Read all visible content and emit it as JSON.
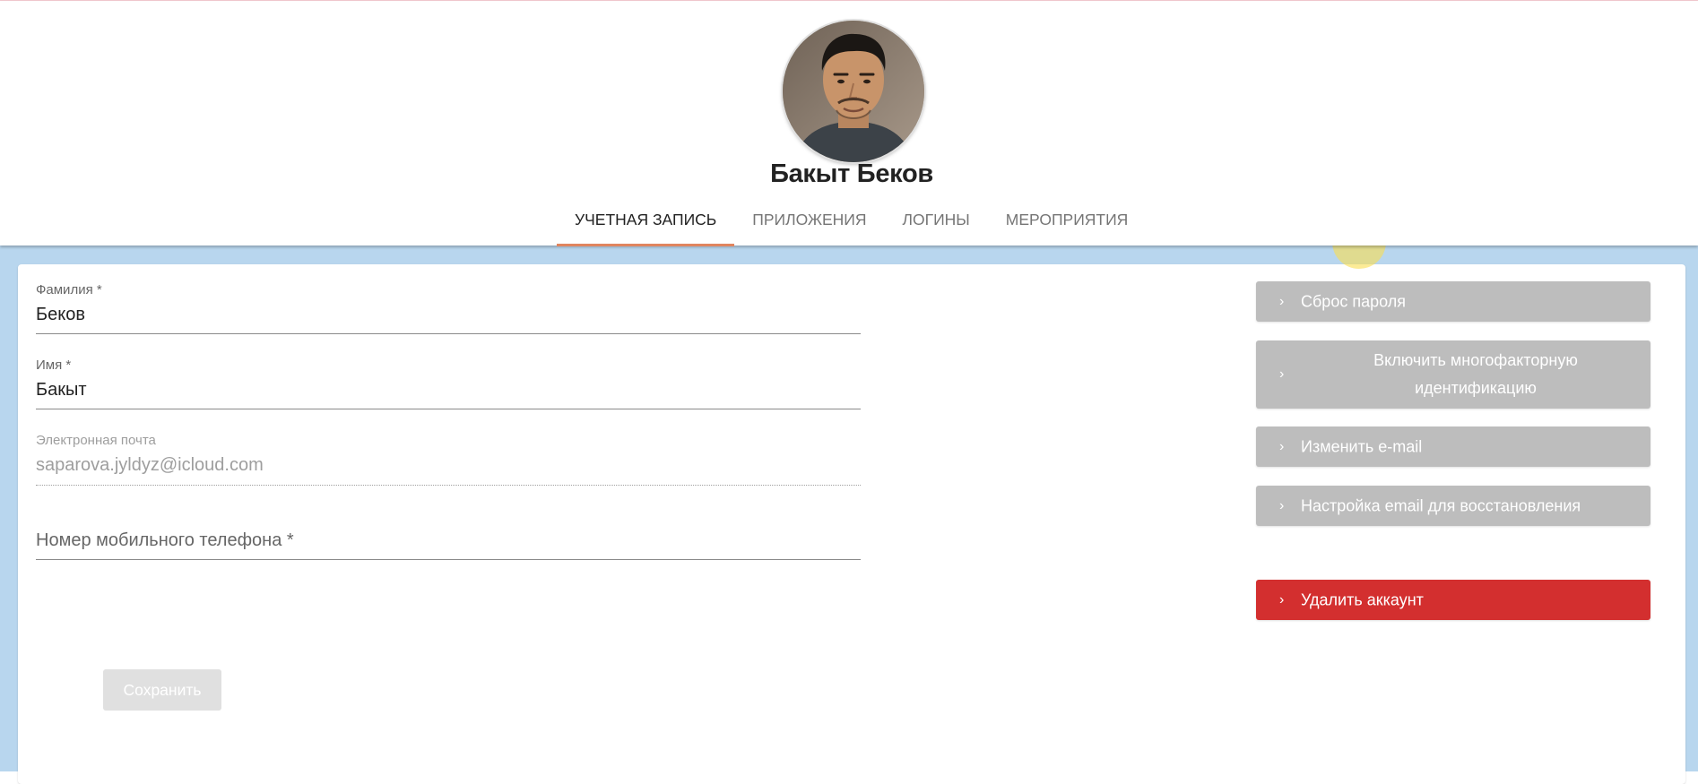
{
  "profile": {
    "name": "Бакыт Беков"
  },
  "tabs": [
    {
      "label": "Учетная запись",
      "active": true
    },
    {
      "label": "Приложения",
      "active": false
    },
    {
      "label": "Логины",
      "active": false
    },
    {
      "label": "Мероприятия",
      "active": false
    }
  ],
  "form": {
    "last_name": {
      "label": "Фамилия *",
      "value": "Беков"
    },
    "first_name": {
      "label": "Имя *",
      "value": "Бакыт"
    },
    "email": {
      "label": "Электронная почта",
      "value": "saparova.jyldyz@icloud.com",
      "disabled": true
    },
    "phone": {
      "placeholder": "Номер мобильного телефона *",
      "value": ""
    },
    "save_label": "Сохранить"
  },
  "actions": {
    "reset_password": "Сброс пароля",
    "enable_mfa": "Включить многофакторную идентификацию",
    "change_email": "Изменить e-mail",
    "recovery_email": "Настройка email для восстановления",
    "delete_account": "Удалить аккаунт"
  },
  "icons": {
    "action_chevron": "chevron-right-icon"
  },
  "colors": {
    "tab_indicator": "#e0855f",
    "content_background": "#b8d6ee",
    "action_button": "#bdbdbd",
    "danger_button": "#d32f2f",
    "save_button_disabled": "#e0e0e0"
  }
}
